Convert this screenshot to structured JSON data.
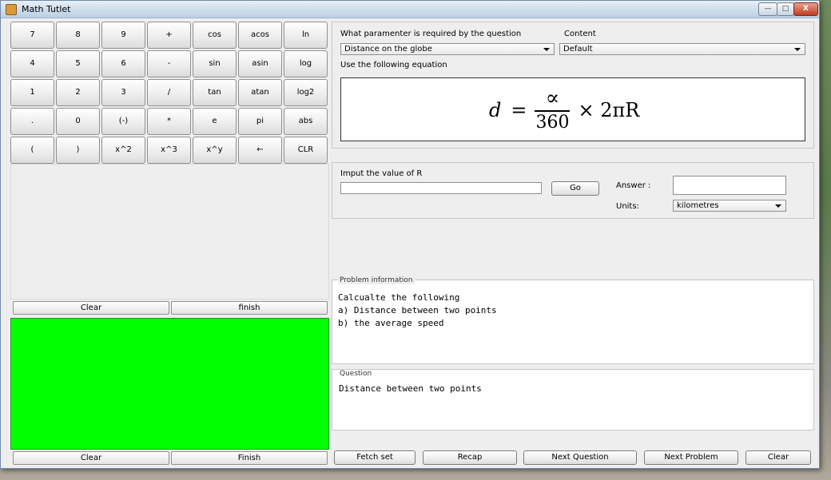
{
  "window": {
    "title": "Math Tutlet",
    "controls": {
      "minimize": "—",
      "maximize": "□",
      "close": "X"
    }
  },
  "calculator": {
    "rows": [
      [
        "7",
        "8",
        "9",
        "+",
        "cos",
        "acos",
        "ln"
      ],
      [
        "4",
        "5",
        "6",
        "-",
        "sin",
        "asin",
        "log"
      ],
      [
        "1",
        "2",
        "3",
        "/",
        "tan",
        "atan",
        "log2"
      ],
      [
        ".",
        "0",
        "(-)",
        "*",
        "e",
        "pi",
        "abs"
      ],
      [
        "(",
        ")",
        "x^2",
        "x^3",
        "x^y",
        "←",
        "CLR"
      ]
    ],
    "clear_label": "Clear",
    "finish_label": "finish"
  },
  "green_panel": {
    "clear_label": "Clear",
    "finish_label": "Finish"
  },
  "question_setup": {
    "parameter_label": "What paramenter is required by the question",
    "parameter_value": "Distance on the globe",
    "content_label": "Content",
    "content_value": "Default",
    "equation_label": "Use the following equation",
    "equation": {
      "lhs": "d",
      "eq": "=",
      "num": "∝",
      "den": "360",
      "rhs": "× 2πR"
    }
  },
  "input_section": {
    "input_label": "Imput the value of R",
    "input_value": "",
    "go_label": "Go",
    "answer_label": "Answer :",
    "answer_value": "",
    "units_label": "Units:",
    "units_value": "kilometres"
  },
  "problem_info": {
    "title": "Problem information",
    "lines": [
      "Calcualte the following",
      "a) Distance between two points",
      "b) the average speed"
    ]
  },
  "question": {
    "title": "Question",
    "text": "Distance between two points"
  },
  "bottom_bar": {
    "fetch_set": "Fetch set",
    "recap": "Recap",
    "next_question": "Next Question",
    "next_problem": "Next Problem",
    "clear": "Clear"
  }
}
